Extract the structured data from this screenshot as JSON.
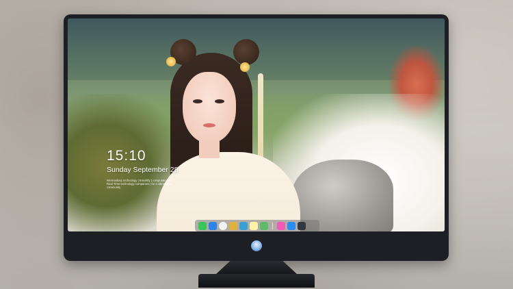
{
  "lockscreen": {
    "time": "15:10",
    "date": "Sunday September 28",
    "note": "intermediary technology | Emulsify | computational | Real-Time technology companies | for a vibrant life | community"
  },
  "dock": {
    "apps": [
      {
        "name": "messages-icon",
        "color": "#38c55a"
      },
      {
        "name": "finder-icon",
        "color": "#2c86e9"
      },
      {
        "name": "safari-icon",
        "color": "#f2f2f2"
      },
      {
        "name": "photos-icon",
        "color": "#e0b13b"
      },
      {
        "name": "clapper-icon",
        "color": "#3aa0d4"
      },
      {
        "name": "notes-icon",
        "color": "#fff3a8"
      },
      {
        "name": "preview-icon",
        "color": "#5dbb6a"
      },
      {
        "name": "music-icon",
        "color": "#f15bb5"
      },
      {
        "name": "appstore-icon",
        "color": "#2e8cf0"
      },
      {
        "name": "camera-icon",
        "color": "#333740"
      }
    ]
  },
  "colors": {
    "bezel": "#1d1f24",
    "accent": "#7cb0e6"
  }
}
